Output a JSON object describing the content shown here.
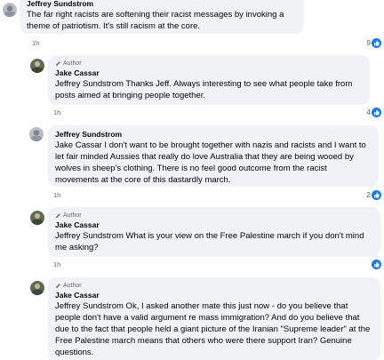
{
  "comments": [
    {
      "author": "Jeffrey Sundstrom",
      "text": "The far right racists are softening their racist messages by invoking a theme of patriotism. It's still racism at the core.",
      "time": "1h",
      "like_count": "9"
    },
    {
      "badge": "Author",
      "author": "Jake Cassar",
      "text": "Jeffrey Sundstrom Thanks Jeff. Always interesting to see what people take from posts aimed at bringing people together.",
      "time": "1h",
      "like_count": "4"
    },
    {
      "author": "Jeffrey Sundstrom",
      "text": "Jake Cassar I don't want to be brought together with nazis and racists and I want to let fair minded Aussies that really do love Australia that they are being wooed by wolves in sheep's clothing. There is no feel good outcome from the racist movements at the core of this dastardly march.",
      "time": "1h",
      "like_count": "2"
    },
    {
      "badge": "Author",
      "author": "Jake Cassar",
      "text": "Jeffrey Sundstrom What is your view on the Free Palestine march if you don't mind me asking?",
      "time": "1h",
      "like_count": ""
    },
    {
      "badge": "Author",
      "author": "Jake Cassar",
      "text": "Jeffrey Sundstrom Ok, I asked another mate this just now - do you believe that people don't have a valid argument re mass immigration? And do you believe that due to the fact that people held a giant picture of the Iranian \"Supreme leader\" at the Free Palestine march means that others who were there support Iran? Genuine questions."
    }
  ],
  "icons": {
    "like": "like-thumb-icon",
    "author_badge": "pen-icon"
  },
  "colors": {
    "bubble": "#f0f2f5",
    "like_blue": "#1877f2",
    "secondary_text": "#65676b"
  }
}
